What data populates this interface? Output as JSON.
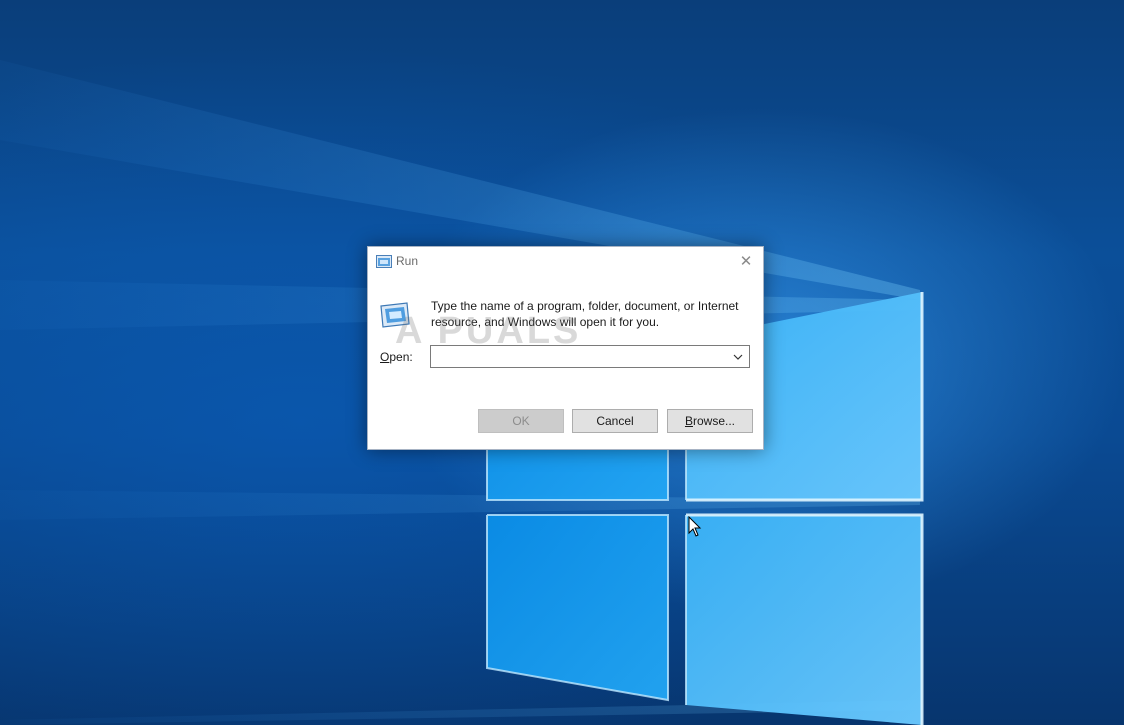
{
  "dialog": {
    "title": "Run",
    "close_glyph": "✕",
    "message": "Type the name of a program, folder, document, or Internet resource, and Windows will open it for you.",
    "open_label_accel": "O",
    "open_label_rest": "pen:",
    "open_value": "",
    "ok_label": "OK",
    "cancel_label": "Cancel",
    "browse_accel": "B",
    "browse_rest": "rowse...",
    "ok_enabled": false
  },
  "watermark": "A  PUALS",
  "icons": {
    "title": "run-icon",
    "big": "run-icon",
    "close": "close-icon",
    "dropdown": "chevron-down-icon",
    "cursor": "mouse-pointer-icon"
  },
  "colors": {
    "desktop_blue": "#0b4f99",
    "light_beam": "#5ec8ff",
    "dialog_bg": "#ffffff",
    "button_bg": "#e1e1e1",
    "disabled_button_bg": "#cccccc"
  }
}
